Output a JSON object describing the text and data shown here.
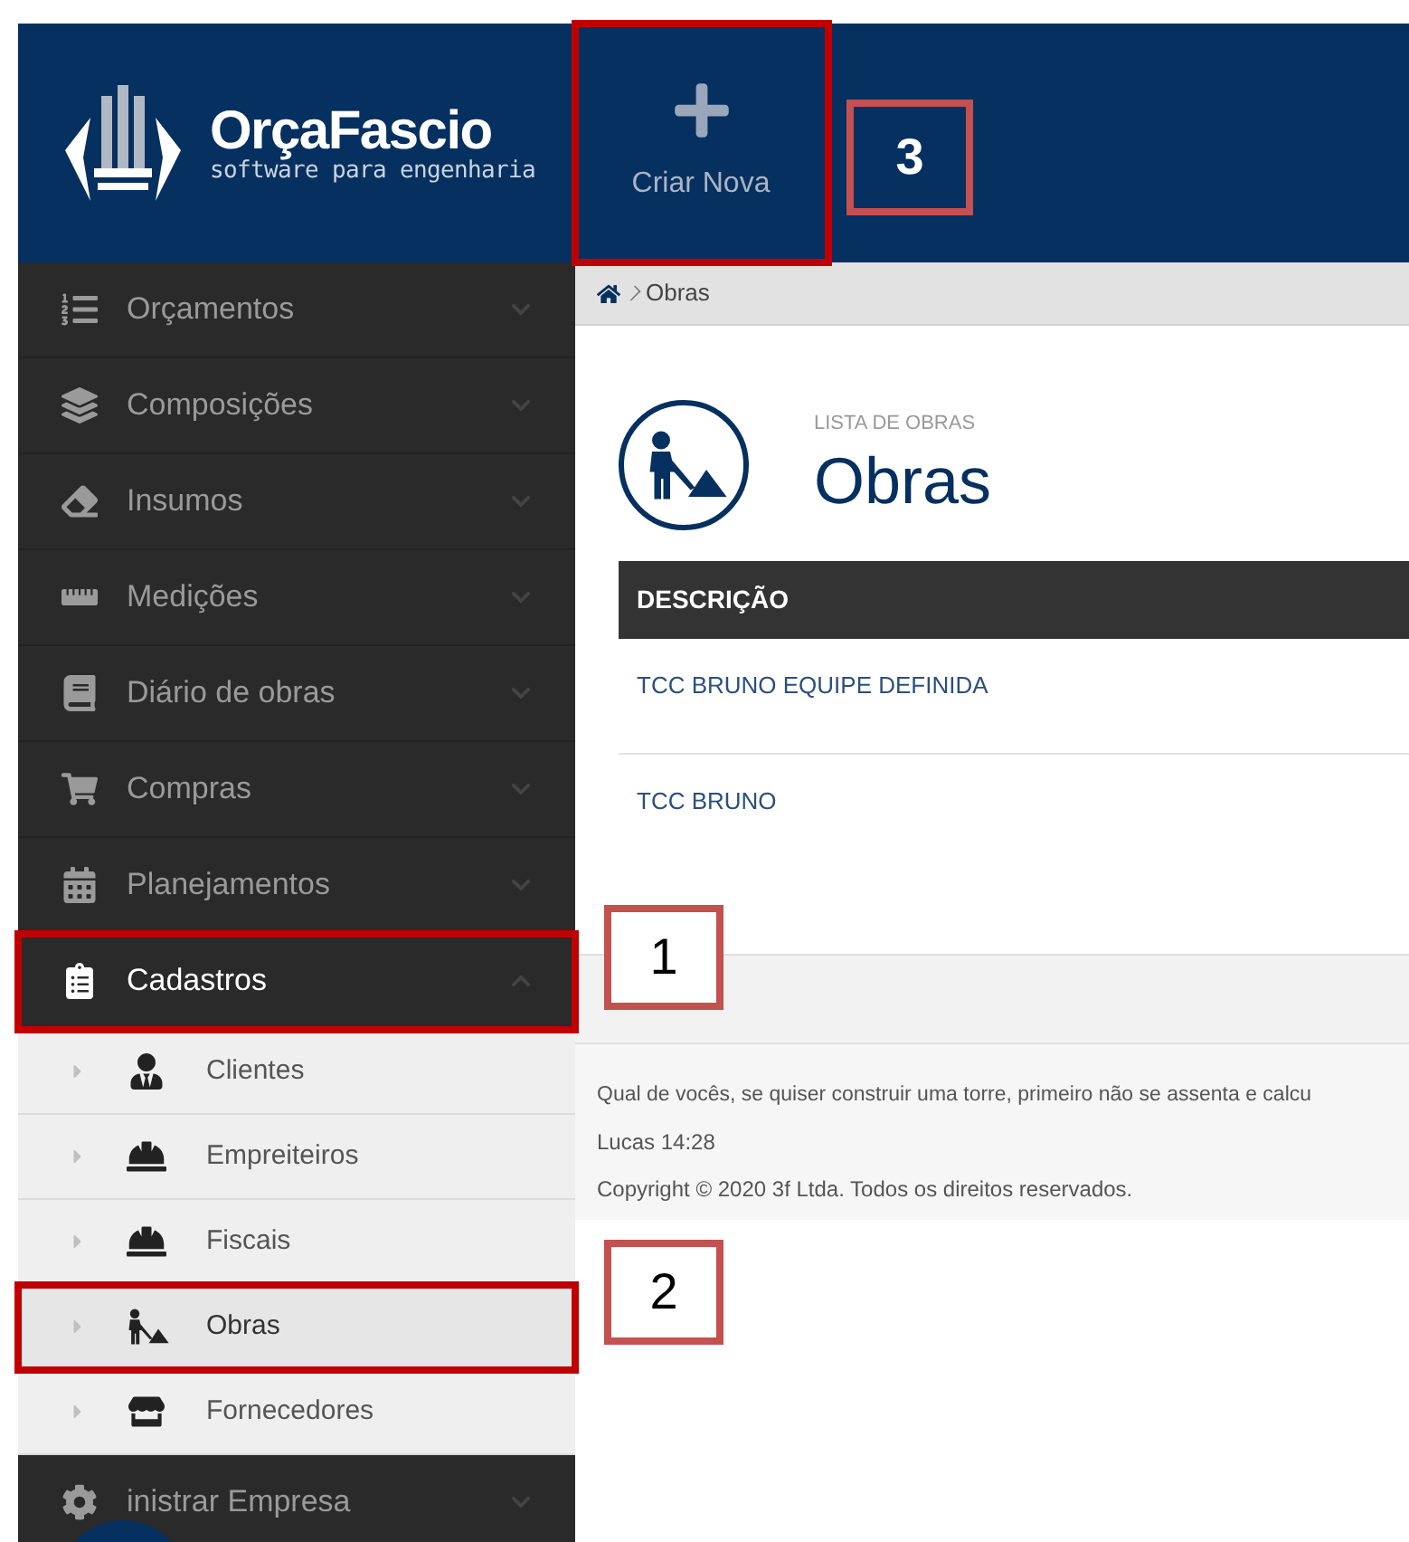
{
  "logo": {
    "name": "OrçaFascio",
    "tagline": "software para engenharia"
  },
  "header": {
    "create_button": {
      "label": "Criar Nova",
      "highlighted": true
    }
  },
  "sidebar": {
    "items": [
      {
        "label": "Orçamentos",
        "expanded": false,
        "highlighted": false
      },
      {
        "label": "Composições",
        "expanded": false,
        "highlighted": false
      },
      {
        "label": "Insumos",
        "expanded": false,
        "highlighted": false
      },
      {
        "label": "Medições",
        "expanded": false,
        "highlighted": false
      },
      {
        "label": "Diário de obras",
        "expanded": false,
        "highlighted": false
      },
      {
        "label": "Compras",
        "expanded": false,
        "highlighted": false
      },
      {
        "label": "Planejamentos",
        "expanded": false,
        "highlighted": false
      },
      {
        "label": "Cadastros",
        "expanded": true,
        "highlighted": true,
        "children": [
          {
            "label": "Clientes",
            "selected": false,
            "highlighted": false
          },
          {
            "label": "Empreiteiros",
            "selected": false,
            "highlighted": false
          },
          {
            "label": "Fiscais",
            "selected": false,
            "highlighted": false
          },
          {
            "label": "Obras",
            "selected": true,
            "highlighted": true
          },
          {
            "label": "Fornecedores",
            "selected": false,
            "highlighted": false
          }
        ]
      },
      {
        "label": "inistrar Empresa",
        "expanded": false,
        "highlighted": false
      }
    ]
  },
  "breadcrumb": {
    "current": "Obras"
  },
  "page": {
    "subtitle": "LISTA DE OBRAS",
    "title": "Obras"
  },
  "table": {
    "columns": [
      "DESCRIÇÃO"
    ],
    "rows": [
      [
        "TCC BRUNO EQUIPE DEFINIDA"
      ],
      [
        "TCC BRUNO"
      ]
    ]
  },
  "footer": {
    "quote": "Qual de vocês, se quiser construir uma torre, primeiro não se assenta e calcu",
    "reference": "Lucas 14:28",
    "copyright": "Copyright © 2020 3f Ltda. Todos os direitos reservados."
  },
  "annotations": [
    {
      "label": "3"
    },
    {
      "label": "1"
    },
    {
      "label": "2"
    }
  ]
}
